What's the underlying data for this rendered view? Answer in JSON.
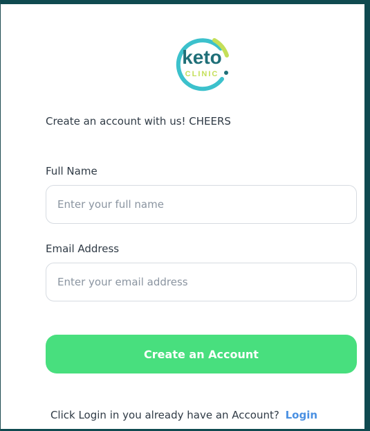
{
  "brand": {
    "word": "keto",
    "subword": "CLINIC",
    "colors": {
      "ring": "#3cc1cc",
      "accent": "#c4df58",
      "text_primary": "#1f6f78"
    },
    "logo_icon": "keto-clinic-logo-icon"
  },
  "intro": {
    "text": "Create an account with us! CHEERS"
  },
  "form": {
    "full_name": {
      "label": "Full Name",
      "placeholder": "Enter your full name",
      "value": ""
    },
    "email": {
      "label": "Email Address",
      "placeholder": "Enter your email address",
      "value": ""
    },
    "submit_label": "Create an Account",
    "colors": {
      "primary_button": "#48df7e"
    }
  },
  "footer": {
    "prompt": "Click Login in you already have an Account?",
    "login_link": "Login",
    "colors": {
      "link": "#4a90e2"
    }
  }
}
